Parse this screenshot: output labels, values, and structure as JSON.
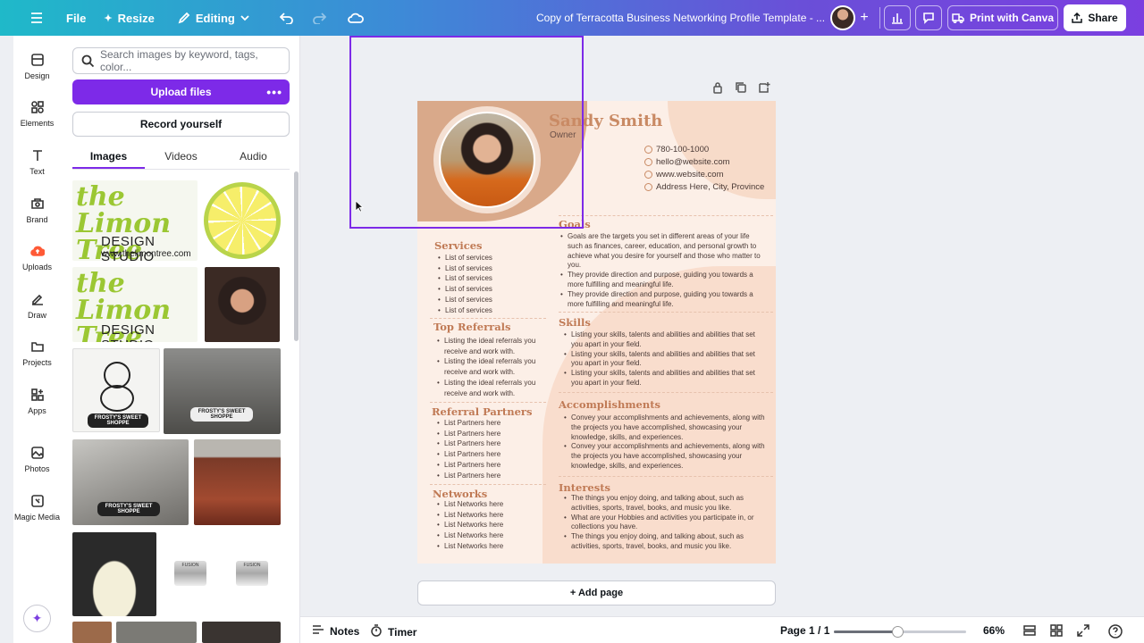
{
  "topbar": {
    "file_label": "File",
    "resize_label": "Resize",
    "editing_label": "Editing",
    "doc_title": "Copy of Terracotta Business Networking Profile Template - ...",
    "print_label": "Print with Canva",
    "share_label": "Share"
  },
  "rail": {
    "items": [
      {
        "label": "Design",
        "icon": "design-icon"
      },
      {
        "label": "Elements",
        "icon": "elements-icon"
      },
      {
        "label": "Text",
        "icon": "text-icon"
      },
      {
        "label": "Brand",
        "icon": "brand-icon"
      },
      {
        "label": "Uploads",
        "icon": "uploads-icon"
      },
      {
        "label": "Draw",
        "icon": "draw-icon"
      },
      {
        "label": "Projects",
        "icon": "projects-icon"
      },
      {
        "label": "Apps",
        "icon": "apps-icon"
      },
      {
        "label": "Photos",
        "icon": "photos-icon"
      },
      {
        "label": "Magic Media",
        "icon": "magic-media-icon"
      }
    ]
  },
  "panel": {
    "search_placeholder": "Search images by keyword, tags, color...",
    "upload_label": "Upload files",
    "record_label": "Record yourself",
    "tabs": [
      "Images",
      "Videos",
      "Audio"
    ],
    "active_tab": "Images",
    "limon_line1": "the Limon Tree",
    "limon_line2": "DESIGN STUDIO",
    "limon_url": "www.thelimontree.com",
    "frosty_label": "FROSTY'S SWEET SHOPPE",
    "fusion_label": "FUSION"
  },
  "resume": {
    "name": "Sandy Smith",
    "role": "Owner",
    "contacts": [
      "780-100-1000",
      "hello@website.com",
      "www.website.com",
      "Address Here, City, Province"
    ],
    "services_title": "Services",
    "services": [
      "List of services",
      "List of services",
      "List of services",
      "List of services",
      "List of services",
      "List of services"
    ],
    "referrals_title": "Top Referrals",
    "referrals": [
      "Listing the ideal referrals you receive and work with.",
      "Listing the ideal referrals you receive and work with.",
      "Listing the ideal referrals you receive and work with."
    ],
    "partners_title": "Referral Partners",
    "partners": [
      "List Partners here",
      "List Partners here",
      "List Partners here",
      "List Partners here",
      "List Partners here",
      "List Partners here"
    ],
    "networks_title": "Networks",
    "networks": [
      "List Networks here",
      "List Networks here",
      "List Networks here",
      "List Networks here",
      "List Networks here"
    ],
    "goals_title": "Goals",
    "goals": [
      "Goals are the targets you set in different areas of your life such as finances, career, education, and personal growth to achieve what you desire for yourself and those who matter to you.",
      "They provide direction and purpose, guiding you towards a more fulfilling and meaningful life.",
      "They provide direction and purpose, guiding you towards a more fulfilling and meaningful life."
    ],
    "skills_title": "Skills",
    "skills": [
      "Listing your skills,  talents and abilities and abilities that set you apart in your field.",
      "Listing your skills, talents and abilities and abilities that set you apart in your field.",
      "Listing your skills, talents and abilities and abilities that set you apart in your field."
    ],
    "accomplishments_title": "Accomplishments",
    "accomplishments": [
      "Convey your accomplishments and achievements, along with the projects you have accomplished, showcasing your knowledge, skills, and experiences.",
      "Convey your accomplishments and achievements, along with the projects you have accomplished, showcasing your knowledge, skills, and experiences."
    ],
    "interests_title": "Interests",
    "interests": [
      "The things you enjoy doing, and talking about, such as activities, sports, travel, books, and music you like.",
      "What are your Hobbies and activities you participate in, or collections you have.",
      "The things you enjoy doing, and talking about, such as activities, sports, travel, books, and music you like."
    ]
  },
  "canvas": {
    "add_page_label": "+ Add page"
  },
  "bottombar": {
    "notes_label": "Notes",
    "timer_label": "Timer",
    "page_label": "Page 1 / 1",
    "zoom_label": "66%",
    "zoom_fraction": 0.48
  },
  "colors": {
    "accent": "#7d2ae8",
    "resume_heading": "#c07a55",
    "resume_bg": "#fcefe7"
  }
}
